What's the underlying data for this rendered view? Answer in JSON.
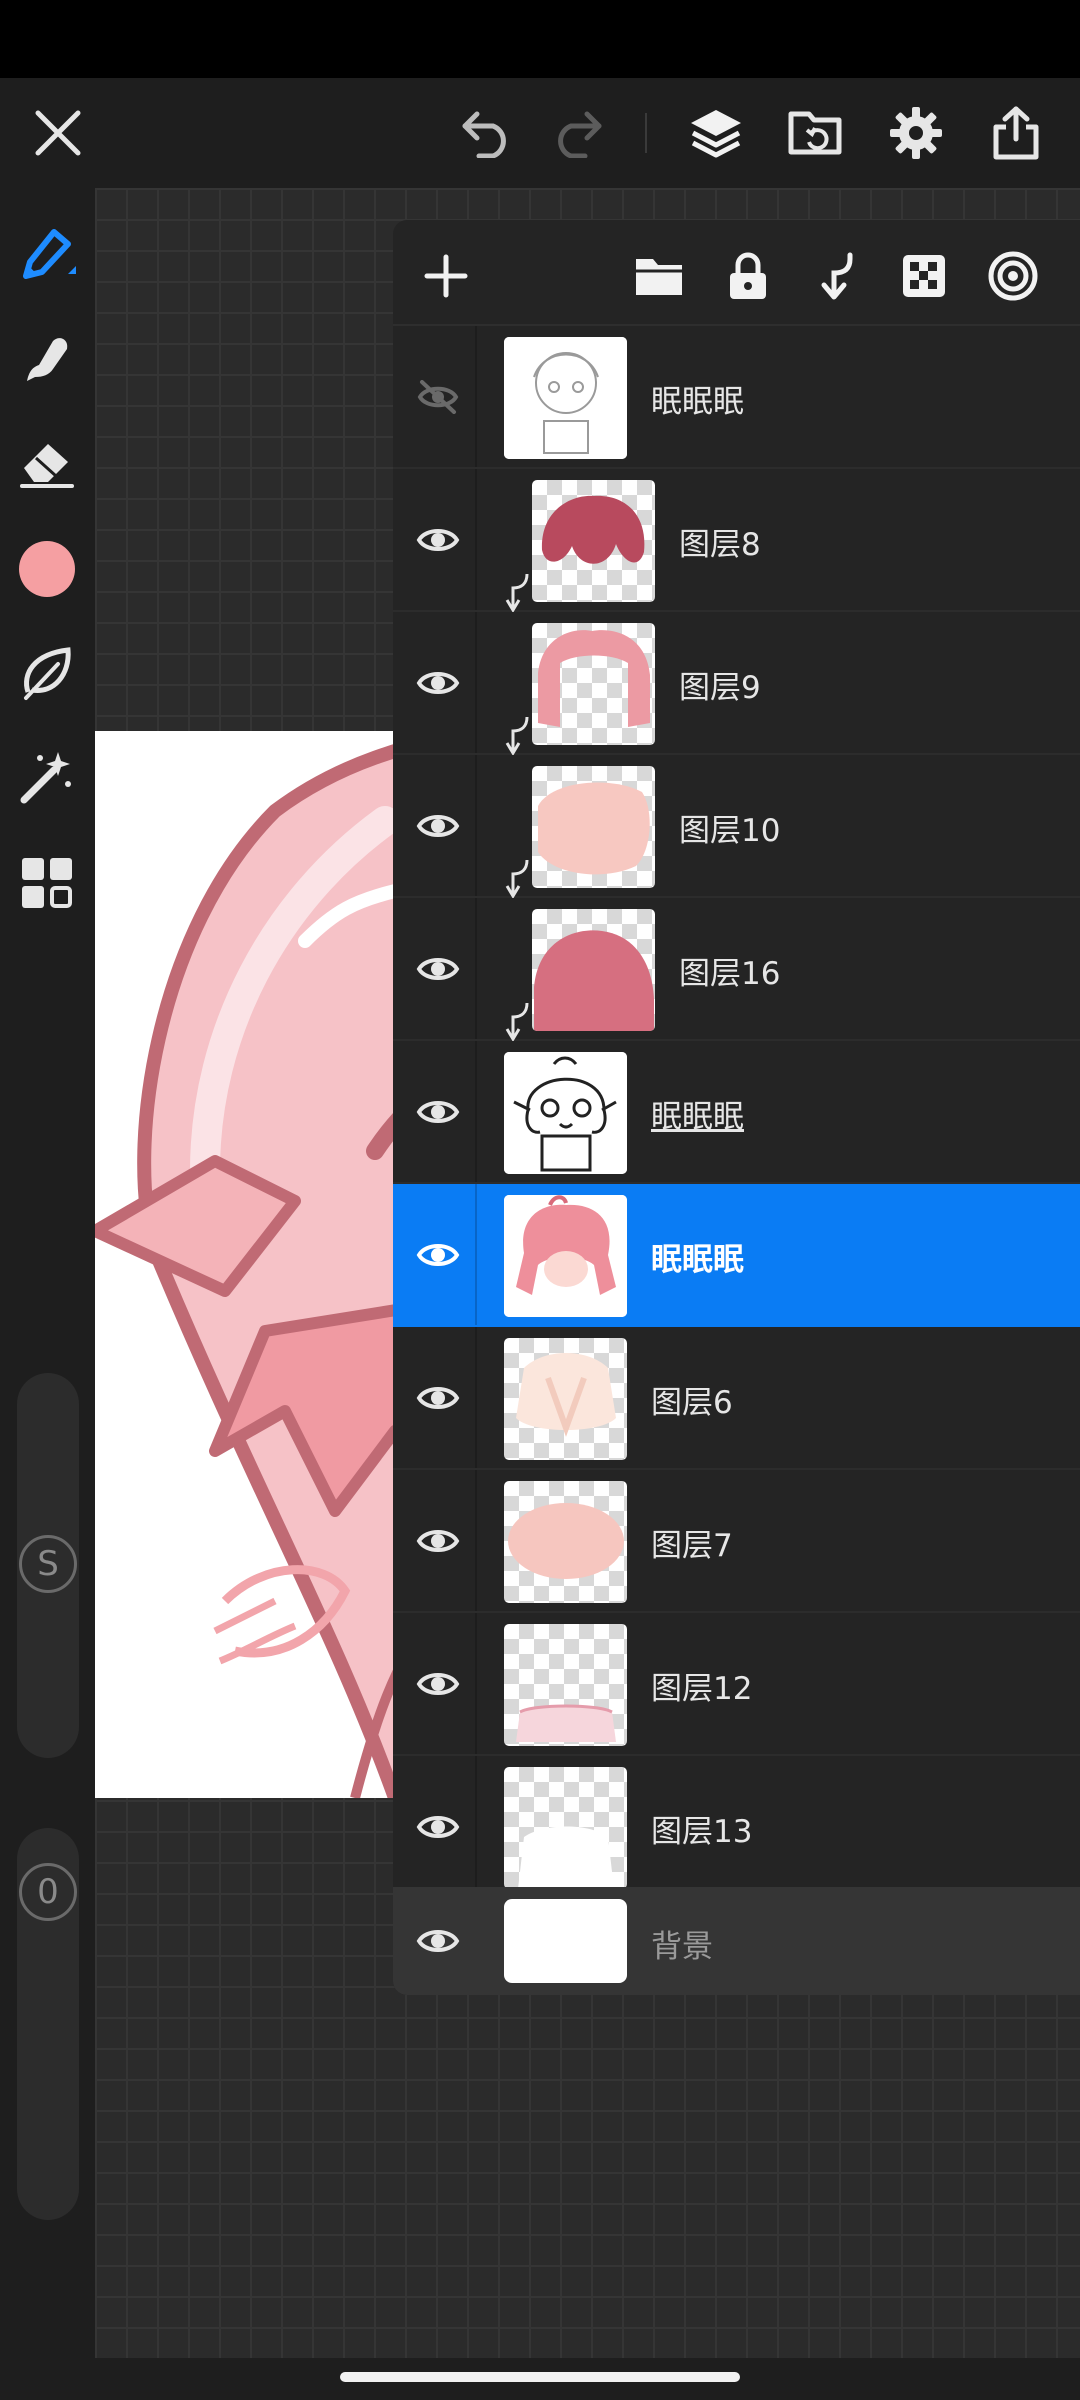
{
  "toolbar": {
    "close": "close-icon",
    "undo": "undo-icon",
    "redo": "redo-icon",
    "layers": "layers-icon",
    "file": "folder-refresh-icon",
    "settings": "gear-icon",
    "share": "share-icon"
  },
  "sidebar": {
    "tools": [
      "brush-icon",
      "smudge-icon",
      "eraser-icon",
      "color-swatch",
      "lasso-icon",
      "magic-wand-icon",
      "gallery-icon"
    ],
    "current_color": "#f59fa2",
    "size_slider_label": "S",
    "opacity_slider_label": "0"
  },
  "layers_panel": {
    "header_actions": [
      "add-layer-icon",
      "new-folder-icon",
      "lock-icon",
      "clip-icon",
      "alpha-lock-icon",
      "blend-target-icon"
    ],
    "layers": [
      {
        "name": "眠眠眠",
        "visible": false,
        "clipped": false
      },
      {
        "name": "图层8",
        "visible": true,
        "clipped": true
      },
      {
        "name": "图层9",
        "visible": true,
        "clipped": true
      },
      {
        "name": "图层10",
        "visible": true,
        "clipped": true
      },
      {
        "name": "图层16",
        "visible": true,
        "clipped": true
      },
      {
        "name": "眠眠眠",
        "visible": true,
        "clipped": false
      },
      {
        "name": "眠眠眠",
        "visible": true,
        "clipped": false,
        "selected": true
      },
      {
        "name": "图层6",
        "visible": true,
        "clipped": false
      },
      {
        "name": "图层7",
        "visible": true,
        "clipped": false
      },
      {
        "name": "图层12",
        "visible": true,
        "clipped": false
      },
      {
        "name": "图层13",
        "visible": true,
        "clipped": false
      },
      {
        "name": "背景",
        "visible": true,
        "clipped": false,
        "background": true
      }
    ]
  },
  "colors": {
    "selected_row": "#0a7cf4",
    "accent_tool": "#1e8cff",
    "canvas_bg": "#2b2b2b"
  }
}
